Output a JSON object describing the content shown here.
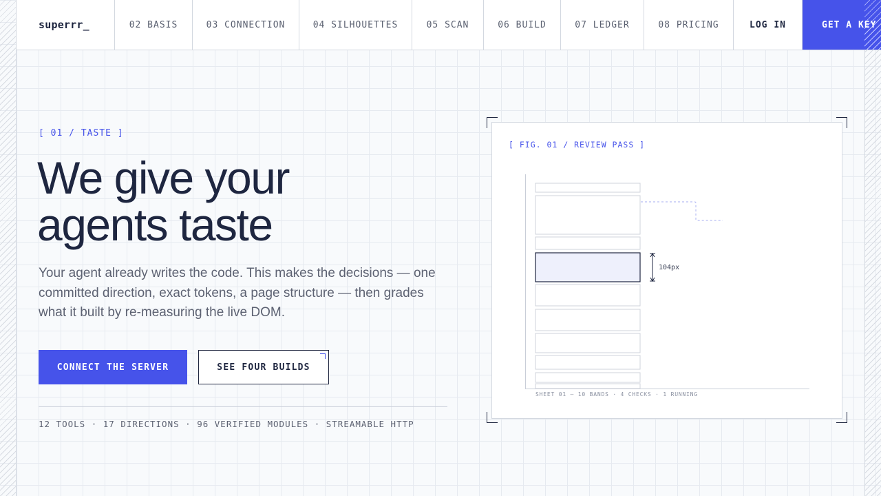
{
  "nav": {
    "brand": "superrr_",
    "items": [
      {
        "label": "02 BASIS"
      },
      {
        "label": "03 CONNECTION"
      },
      {
        "label": "04 SILHOUETTES"
      },
      {
        "label": "05 SCAN"
      },
      {
        "label": "06 BUILD"
      },
      {
        "label": "07 LEDGER"
      },
      {
        "label": "08 PRICING"
      }
    ],
    "login": "LOG IN",
    "cta": "GET A KEY"
  },
  "hero": {
    "eyebrow": "[ 01 / TASTE ]",
    "headline_line1": "We give your",
    "headline_line2": "agents taste",
    "lede": "Your agent already writes the code. This makes the decisions — one committed direction, exact tokens, a page structure — then grades what it built by re-measuring the live DOM.",
    "primary_button": "CONNECT THE SERVER",
    "secondary_button": "SEE FOUR BUILDS",
    "stats": "12 TOOLS · 17 DIRECTIONS · 96 VERIFIED MODULES · STREAMABLE HTTP"
  },
  "figure": {
    "title": "[ FIG. 01 / REVIEW PASS ]",
    "measurement": "104px",
    "caption": "SHEET 01 — 10 BANDS · 4 CHECKS · 1 RUNNING",
    "highlighted_band": 4
  },
  "colors": {
    "accent": "#4653ea",
    "ink": "#1e2640",
    "muted": "#5d6272",
    "background": "#f8fafc",
    "highlight_fill": "#eef0fc"
  }
}
